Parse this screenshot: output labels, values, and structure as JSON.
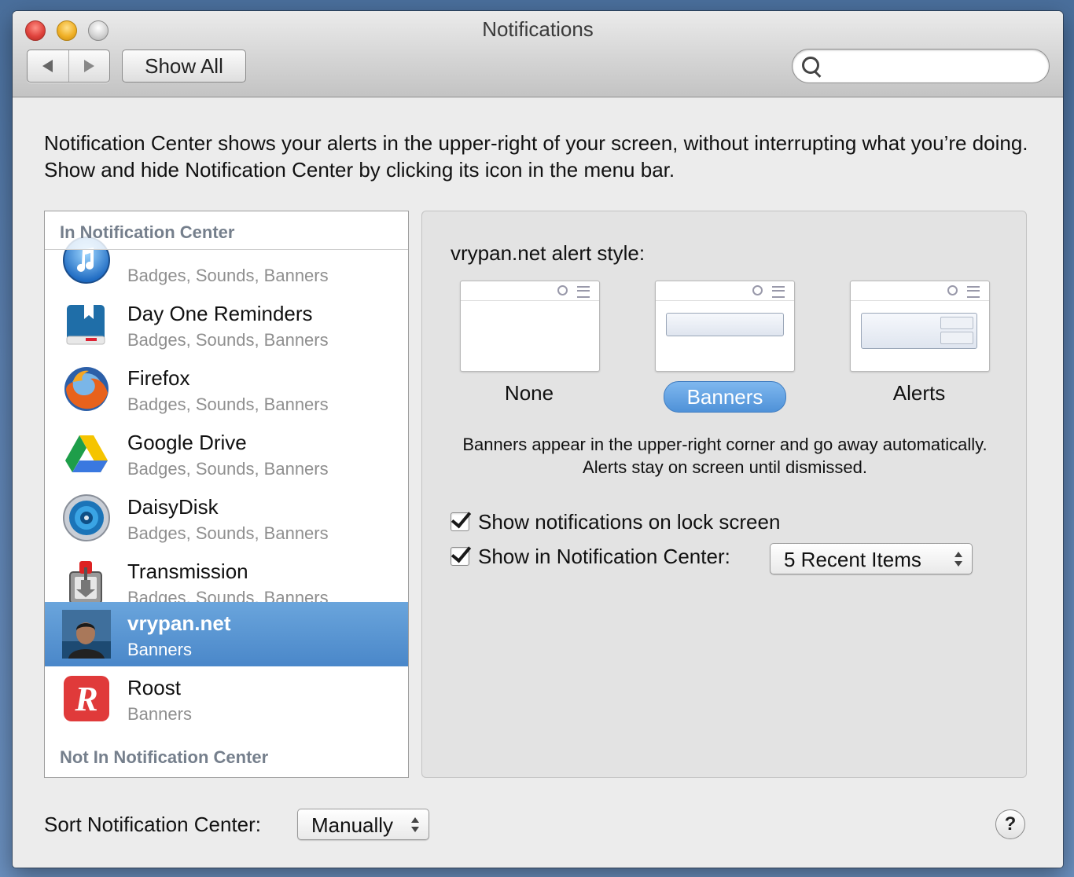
{
  "window": {
    "title": "Notifications"
  },
  "toolbar": {
    "show_all_label": "Show All",
    "search_placeholder": ""
  },
  "intro_text": "Notification Center shows your alerts in the upper-right of your screen, without interrupting what you’re doing. Show and hide Notification Center by clicking its icon in the menu bar.",
  "list": {
    "section_in": "In Notification Center",
    "section_in_ghost": "iTunes",
    "section_not_in": "Not In Notification Center",
    "items": [
      {
        "name": "iTunes",
        "sub": "Badges, Sounds, Banners",
        "icon": "itunes-icon"
      },
      {
        "name": "Day One Reminders",
        "sub": "Badges, Sounds, Banners",
        "icon": "day-one-icon"
      },
      {
        "name": "Firefox",
        "sub": "Badges, Sounds, Banners",
        "icon": "firefox-icon"
      },
      {
        "name": "Google Drive",
        "sub": "Badges, Sounds, Banners",
        "icon": "google-drive-icon"
      },
      {
        "name": "DaisyDisk",
        "sub": "Badges, Sounds, Banners",
        "icon": "daisydisk-icon"
      },
      {
        "name": "Transmission",
        "sub": "Badges, Sounds, Banners",
        "icon": "transmission-icon"
      },
      {
        "name": "vrypan.net",
        "sub": "Banners",
        "icon": "avatar-photo-icon",
        "selected": true
      },
      {
        "name": "Roost",
        "sub": "Banners",
        "icon": "roost-icon"
      }
    ]
  },
  "detail": {
    "alert_style_label": "vrypan.net alert style:",
    "styles": [
      {
        "label": "None"
      },
      {
        "label": "Banners",
        "selected": true
      },
      {
        "label": "Alerts"
      }
    ],
    "description": "Banners appear in the upper-right corner and go away automatically. Alerts stay on screen until dismissed.",
    "lock_screen_label": "Show notifications on lock screen",
    "lock_screen_checked": true,
    "show_in_nc_label": "Show in Notification Center:",
    "show_in_nc_checked": true,
    "recent_items_value": "5 Recent Items"
  },
  "footer": {
    "sort_label": "Sort Notification Center:",
    "sort_value": "Manually",
    "help_label": "?"
  },
  "colors": {
    "selection": "#4a87c9",
    "section_header": "#757f8c"
  }
}
